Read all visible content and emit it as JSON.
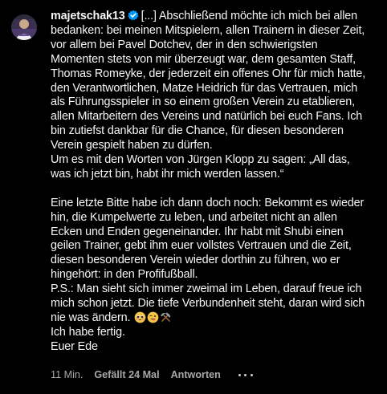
{
  "comment": {
    "username": "majetschak13",
    "icons": {
      "avatar": "user-avatar",
      "verified": "verified-badge-icon",
      "more": "more-options-icon"
    },
    "colors": {
      "background": "#000000",
      "text": "#f5f5f5",
      "meta_text": "#a8a8a8",
      "verified_badge": "#0095f6"
    },
    "first_line_text": "[...] Abschließend möchte ich mich bei allen",
    "lines": [
      "bedanken: bei meinen Mitspielern, allen Trainern in dieser Zeit,",
      "vor allem bei Pavel Dotchev, der in den schwierigsten",
      "Momenten stets von mir überzeugt war, dem gesamten Staff,",
      "Thomas Romeyke, der jederzeit ein offenes Ohr für mich hatte,",
      "den Verantwortlichen, Matze Heidrich für das Vertrauen, mich",
      "als Führungsspieler in so einem großen Verein zu etablieren,",
      "allen Mitarbeitern des Vereins und natürlich bei euch Fans. Ich",
      "bin zutiefst dankbar für die Chance, für diesen besonderen",
      "Verein gespielt haben zu dürfen.",
      "Um es mit den Worten von Jürgen Klopp zu sagen: „All das,",
      "was ich jetzt bin, habt ihr mich werden lassen.“"
    ],
    "lines_part2": [
      "Eine letzte Bitte habe ich dann doch noch: Bekommt es wieder",
      "hin, die Kumpelwerte zu leben, und arbeitet nicht an allen",
      "Ecken und Enden gegeneinander. Ihr habt mit Shubi einen",
      "geilen Trainer, gebt ihm euer vollstes Vertrauen und die Zeit,",
      "diesen besonderen Verein wieder dorthin zu führen, wo er",
      "hingehört: in den Profifußball.",
      "P.S.: Man sieht sich immer zweimal im Leben, darauf freue ich",
      "mich schon jetzt. Die tiefe Verbundenheit steht, daran wird sich"
    ],
    "emoji_line_text": "nie was ändern.",
    "emojis": [
      "pleading-face-emoji",
      "winking-tongue-face-emoji",
      "hammer-and-pick-emoji"
    ],
    "closing_lines": [
      "Ich habe fertig.",
      "Euer Ede"
    ],
    "footer": {
      "time": "11 Min.",
      "likes": "Gefällt 24 Mal",
      "reply": "Antworten"
    }
  }
}
